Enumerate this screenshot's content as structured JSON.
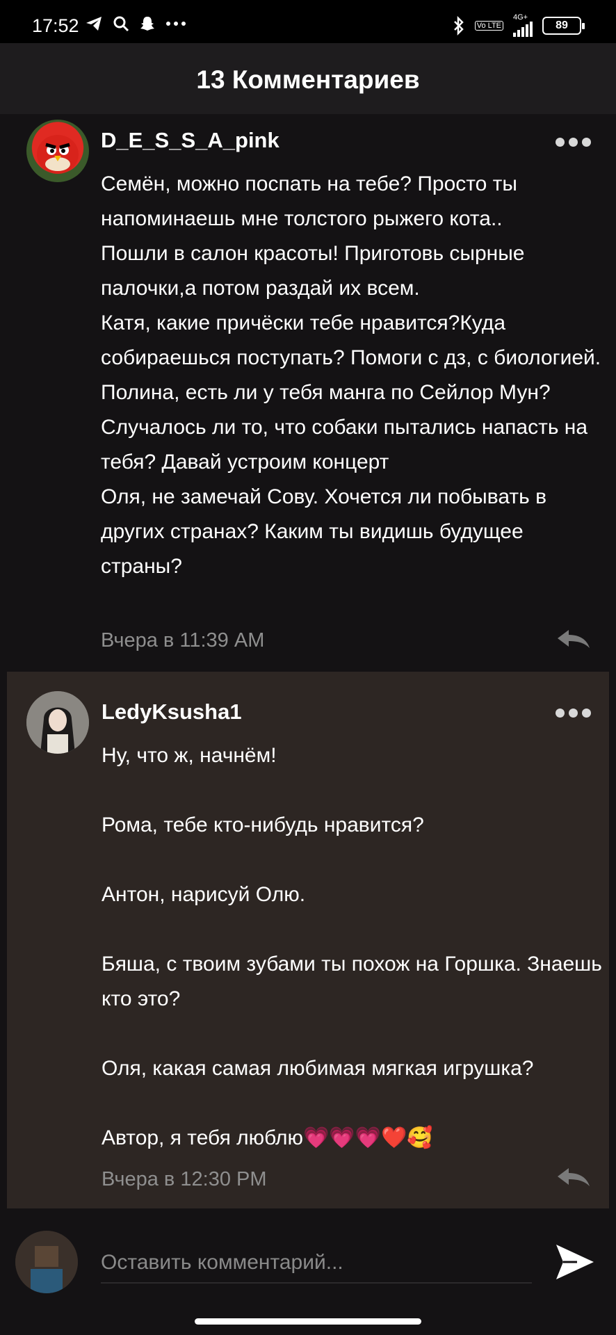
{
  "status_bar": {
    "time": "17:52",
    "battery": "89",
    "network": "4G+",
    "lte_badge": "Vo LTE"
  },
  "header": {
    "title": "13 Комментариев"
  },
  "comments": [
    {
      "username": "D_E_S_S_A_pink",
      "text": "Семён, можно поспать на тебе? Просто ты напоминаешь мне толстого рыжего кота..\nПошли в салон красоты! Приготовь сырные палочки,а потом раздай их всем.\nКатя, какие причёски тебе нравится?Куда собираешься поступать? Помоги с дз, с биологией.\nПолина, есть ли у тебя манга по Сейлор Мун? Случалось ли то, что собаки пытались напасть на тебя? Давай устроим концерт\nОля, не замечай Сову. Хочется ли побывать в других странах? Каким ты видишь будущее страны?",
      "time": "Вчера в 11:39 AM"
    },
    {
      "username": "LedyKsusha1",
      "text": "Ну, что ж, начнём!\n\nРома, тебе кто-нибудь нравится?\n\nАнтон, нарисуй Олю.\n\nБяша, с твоим зубами ты похож на Горшка. Знаешь кто это?\n\nОля, какая самая любимая мягкая игрушка?\n\nАвтор, я тебя люблю💗💗💗❤️🥰",
      "time": "Вчера в 12:30 PM"
    }
  ],
  "composer": {
    "placeholder": "Оставить комментарий..."
  },
  "colors": {
    "background": "#141214",
    "highlight_comment": "#2d2623",
    "header": "#1e1c1e",
    "muted_text": "#8f8f8f"
  }
}
